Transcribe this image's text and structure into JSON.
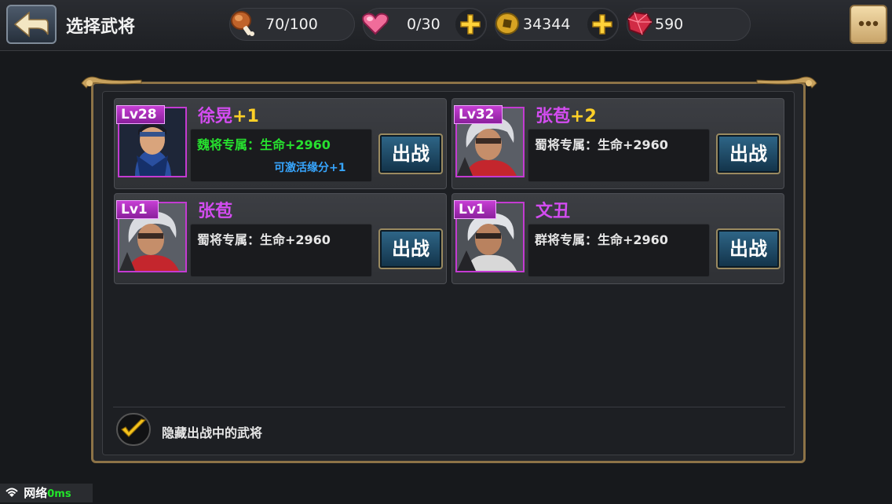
{
  "header": {
    "title": "选择武将",
    "resources": [
      {
        "name": "stamina",
        "icon": "meat-icon",
        "value": "70/100",
        "has_plus": false
      },
      {
        "name": "energy",
        "icon": "heart-icon",
        "value": "0/30",
        "has_plus": true
      },
      {
        "name": "coins",
        "icon": "coin-icon",
        "value": "34344",
        "has_plus": true
      },
      {
        "name": "gems",
        "icon": "gem-icon",
        "value": "590",
        "has_plus": false
      }
    ]
  },
  "heroes": [
    {
      "level": "Lv28",
      "name": "徐晃",
      "plus": "+1",
      "bonus": "魏将专属：生命+2960",
      "bonus_color": "#27e02f",
      "fate": "可激活缘分+1",
      "button": "出战"
    },
    {
      "level": "Lv32",
      "name": "张苞",
      "plus": "+2",
      "bonus": "蜀将专属：生命+2960",
      "bonus_color": "#e6e6e6",
      "fate": "",
      "button": "出战"
    },
    {
      "level": "Lv1",
      "name": "张苞",
      "plus": "",
      "bonus": "蜀将专属：生命+2960",
      "bonus_color": "#e6e6e6",
      "fate": "",
      "button": "出战"
    },
    {
      "level": "Lv1",
      "name": "文丑",
      "plus": "",
      "bonus": "群将专属：生命+2960",
      "bonus_color": "#e6e6e6",
      "fate": "",
      "button": "出战"
    }
  ],
  "footer": {
    "checkbox_label": "隐藏出战中的武将",
    "checked": true
  },
  "network": {
    "label": "网络",
    "latency": "0ms"
  },
  "colors": {
    "frame_gold": "#8d7347",
    "name_purple": "#d34cf0",
    "plus_yellow": "#ffd027",
    "fate_blue": "#37a6ff"
  }
}
